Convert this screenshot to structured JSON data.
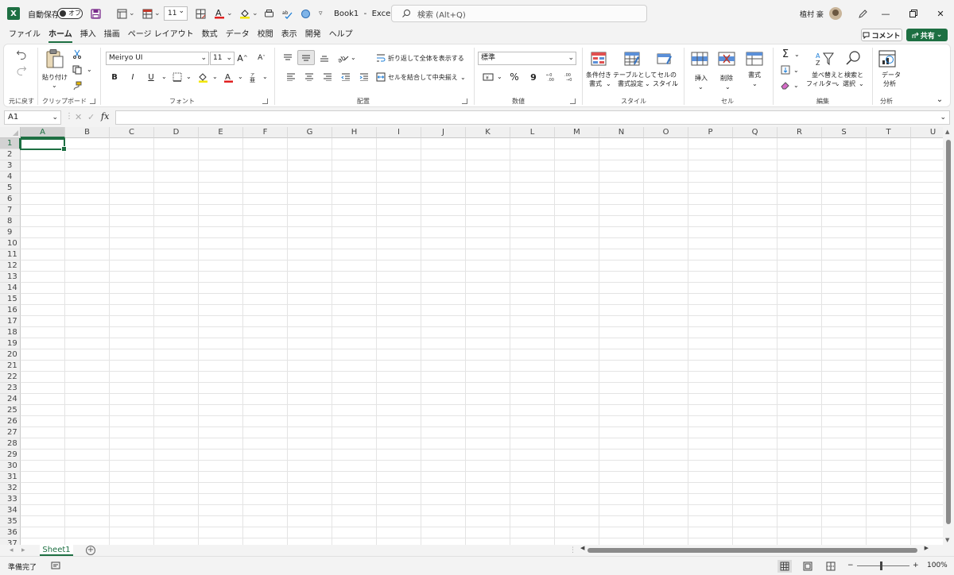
{
  "titlebar": {
    "logo_letter": "X",
    "autosave_label": "自動保存",
    "autosave_state": "オフ",
    "font_size_value": "11",
    "title": "Book1  -  Excel",
    "search_placeholder": "検索 (Alt+Q)",
    "user_name": "植村 豪"
  },
  "tabs": [
    "ファイル",
    "ホーム",
    "挿入",
    "描画",
    "ページ レイアウト",
    "数式",
    "データ",
    "校閲",
    "表示",
    "開発",
    "ヘルプ"
  ],
  "active_tab": "ホーム",
  "comment_button": "コメント",
  "share_button": "共有",
  "ribbon": {
    "undo_group": "元に戻す",
    "clipboard": {
      "label": "クリップボード",
      "paste": "貼り付け"
    },
    "font": {
      "label": "フォント",
      "name": "Meiryo UI",
      "size": "11",
      "bold": "B",
      "italic": "I",
      "underline": "U",
      "grow": "A",
      "shrink": "A"
    },
    "alignment": {
      "label": "配置",
      "wrap": "折り返して全体を表示する",
      "merge": "セルを結合して中央揃え"
    },
    "number": {
      "label": "数値",
      "format": "標準",
      "percent": "%",
      "comma": "9"
    },
    "styles": {
      "label": "スタイル",
      "conditional_1": "条件付き",
      "conditional_2": "書式",
      "table_1": "テーブルとして",
      "table_2": "書式設定",
      "cell_1": "セルの",
      "cell_2": "スタイル"
    },
    "cells": {
      "label": "セル",
      "insert": "挿入",
      "delete": "削除",
      "format": "書式"
    },
    "editing": {
      "label": "編集",
      "sort_1": "並べ替えと",
      "sort_2": "フィルター",
      "find_1": "検索と",
      "find_2": "選択"
    },
    "analysis": {
      "label": "分析",
      "data_1": "データ",
      "data_2": "分析"
    }
  },
  "formula_bar": {
    "name_box": "A1",
    "fx": "fx",
    "value": ""
  },
  "grid": {
    "columns": [
      "A",
      "B",
      "C",
      "D",
      "E",
      "F",
      "G",
      "H",
      "I",
      "J",
      "K",
      "L",
      "M",
      "N",
      "O",
      "P",
      "Q",
      "R",
      "S",
      "T",
      "U"
    ],
    "rows": [
      "1",
      "2",
      "3",
      "4",
      "5",
      "6",
      "7",
      "8",
      "9",
      "10",
      "11",
      "12",
      "13",
      "14",
      "15",
      "16",
      "17",
      "18",
      "19",
      "20",
      "21",
      "22",
      "23",
      "24",
      "25",
      "26",
      "27",
      "28",
      "29",
      "30",
      "31",
      "32",
      "33",
      "34",
      "35",
      "36",
      "37"
    ],
    "active_cell": "A1"
  },
  "sheets": [
    "Sheet1"
  ],
  "status": {
    "ready": "準備完了",
    "zoom": "100%",
    "zoom_minus": "−",
    "zoom_plus": "+"
  },
  "colors": {
    "accent": "#1d6f42"
  }
}
